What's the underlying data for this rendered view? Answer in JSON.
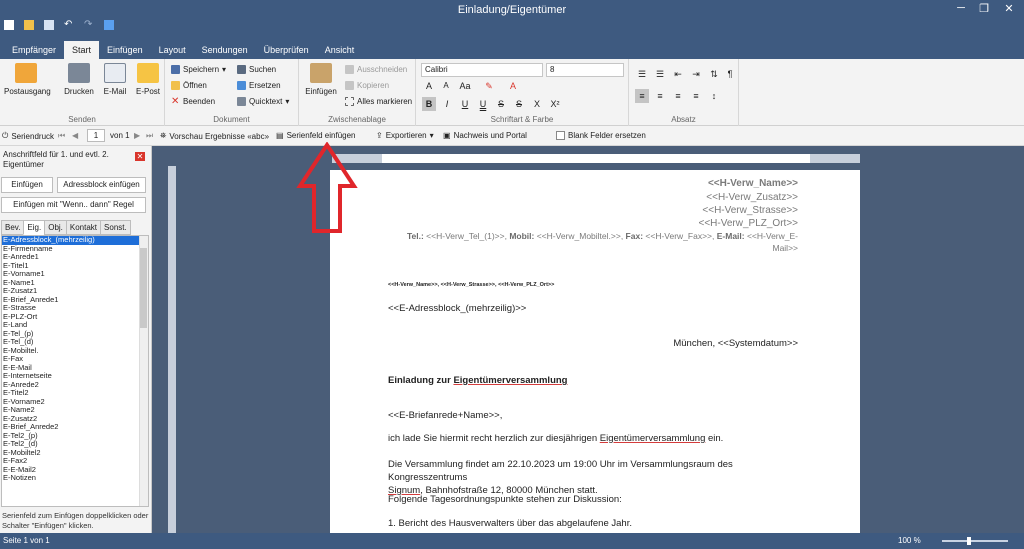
{
  "window": {
    "title": "Einladung/Eigentümer"
  },
  "tabs": [
    "Empfänger",
    "Start",
    "Einfügen",
    "Layout",
    "Sendungen",
    "Überprüfen",
    "Ansicht"
  ],
  "ribbon": {
    "senden": {
      "label": "Senden",
      "postausgang": "Postausgang",
      "drucken": "Drucken",
      "email": "E-Mail",
      "epost": "E-Post"
    },
    "dokument": {
      "label": "Dokument",
      "speichern": "Speichern",
      "oeffnen": "Öffnen",
      "beenden": "Beenden",
      "suchen": "Suchen",
      "ersetzen": "Ersetzen",
      "quicktext": "Quicktext"
    },
    "zwischenablage": {
      "label": "Zwischenablage",
      "einfuegen": "Einfügen",
      "ausschneiden": "Ausschneiden",
      "kopieren": "Kopieren",
      "alles_markieren": "Alles markieren"
    },
    "schrift": {
      "label": "Schriftart & Farbe",
      "font": "Calibri",
      "size": "8"
    },
    "absatz": {
      "label": "Absatz"
    }
  },
  "mailmerge": {
    "serien": "Seriendruck",
    "page_current": "1",
    "page_of": "von 1",
    "vorschau": "Vorschau Ergebnisse «abc»",
    "serienfeld": "Serienfeld einfügen",
    "exportieren": "Exportieren",
    "nachweis": "Nachweis und Portal",
    "blank": "Blank Felder ersetzen"
  },
  "panel": {
    "title": "Anschriftfeld für 1. und evtl. 2. Eigentümer",
    "btn_einfuegen": "Einfügen",
    "btn_adressblock": "Adressblock einfügen",
    "btn_wenn": "Einfügen mit \"Wenn.. dann\" Regel",
    "tabs": [
      "Bev.",
      "Eig.",
      "Obj.",
      "Kontakt",
      "Sonst."
    ],
    "fields": [
      "E-Adressblock_(mehrzeilig)",
      "E-Firmenname",
      "E-Anrede1",
      "E-Titel1",
      "E-Vorname1",
      "E-Name1",
      "E-Zusatz1",
      "E-Brief_Anrede1",
      "E-Strasse",
      "E-PLZ-Ort",
      "E-Land",
      "E-Tel_(p)",
      "E-Tel_(d)",
      "E-Mobiltel.",
      "E-Fax",
      "E-E-Mail",
      "E-Internetseite",
      "E-Anrede2",
      "E-Titel2",
      "E-Vorname2",
      "E-Name2",
      "E-Zusatz2",
      "E-Brief_Anrede2",
      "E-Tel2_(p)",
      "E-Tel2_(d)",
      "E-Mobiltel2",
      "E-Fax2",
      "E-E-Mail2",
      "E-Notizen"
    ],
    "hint": "Serienfeld zum Einfügen doppelklicken oder Schalter \"Einfügen\" klicken."
  },
  "document": {
    "h_name": "<<H-Verw_Name>>",
    "h_zusatz": "<<H-Verw_Zusatz>>",
    "h_strasse": "<<H-Verw_Strasse>>",
    "h_plz": "<<H-Verw_PLZ_Ort>>",
    "tel_label": "Tel.:",
    "tel_val": " <<H-Verw_Tel_(1)>>, ",
    "mobil_label": "Mobil:",
    "mobil_val": " <<H-Verw_Mobiltel.>>, ",
    "fax_label": "Fax:",
    "fax_val": " <<H-Verw_Fax>>, ",
    "email_label": "E-Mail:",
    "email_val": " <<H-Verw_E-",
    "email_cont": "Mail>>",
    "sender_line": "<<H-Verw_Name>>, <<H-Verw_Strasse>>, <<H-Verw_PLZ_Ort>>",
    "adressblock": "<<E-Adressblock_(mehrzeilig)>>",
    "ort_datum": "München, <<Systemdatum>>",
    "subject_a": "Einladung zur ",
    "subject_b": "Eigentümerversammlung",
    "anrede": "<<E-Briefanrede+Name>>,",
    "p1_a": "ich lade Sie hiermit recht herzlich zur diesjährigen ",
    "p1_b": "Eigentümerversammlung",
    "p1_c": " ein.",
    "p2_a": "Die Versammlung findet am 22.10.2023 um 19:00 Uhr im Versammlungsraum des Kongresszentrums",
    "p2_b": "Signum",
    "p2_c": ", Bahnhofstraße 12, 80000 München statt.",
    "p3": "Folgende Tagesordnungspunkte stehen zur Diskussion:",
    "p4": "1. Bericht des Hausverwalters über das abgelaufene Jahr."
  },
  "status": {
    "page": "Seite 1 von 1",
    "zoom": "100 %"
  },
  "colors": {
    "accent": "#3e5a80",
    "selection": "#1e6ed8",
    "arrow": "#e0262b"
  }
}
